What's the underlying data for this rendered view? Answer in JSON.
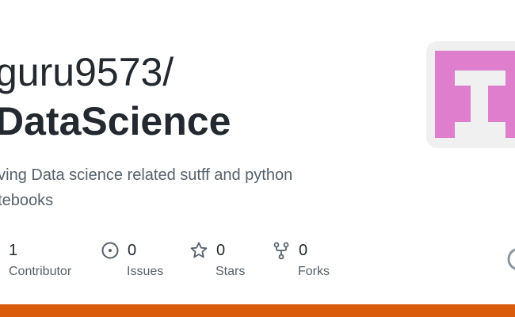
{
  "repo": {
    "owner": "guru9573/",
    "name": "DataScience",
    "description_lines": [
      "aving Data science related sutff and python",
      "otebooks"
    ]
  },
  "stats": [
    {
      "icon": "people-icon",
      "count": "1",
      "label": "Contributor"
    },
    {
      "icon": "issue-icon",
      "count": "0",
      "label": "Issues"
    },
    {
      "icon": "star-icon",
      "count": "0",
      "label": "Stars"
    },
    {
      "icon": "fork-icon",
      "count": "0",
      "label": "Forks"
    }
  ],
  "colors": {
    "accent_bar": "#da5b0b",
    "avatar_fill": "#e07ece",
    "avatar_bg": "#f0f0f0",
    "text_primary": "#24292f",
    "text_secondary": "#57606a"
  },
  "icons": {
    "avatar": "identicon-avatar",
    "logo": "github-logo-icon"
  }
}
